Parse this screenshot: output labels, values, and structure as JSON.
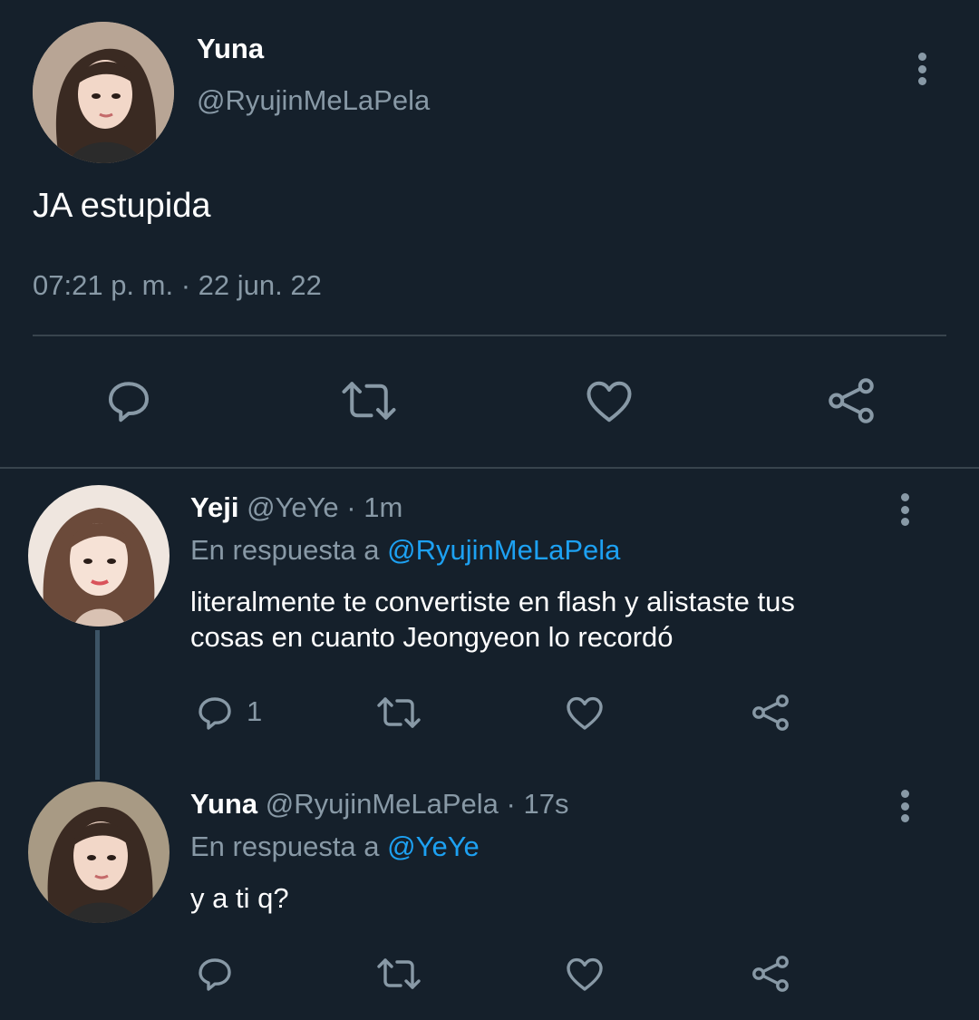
{
  "main_tweet": {
    "display_name": "Yuna",
    "handle": "@RyujinMeLaPela",
    "text": "JA estupida",
    "timestamp": "07:21 p. m. · 22 jun. 22",
    "avatar_icon": "avatar-yuna",
    "actions": [
      "reply-icon",
      "retweet-icon",
      "like-icon",
      "share-icon"
    ]
  },
  "replies": [
    {
      "display_name": "Yeji",
      "handle_time": "@YeYe · 1m",
      "replying_prefix": "En respuesta a",
      "replying_to": "@RyujinMeLaPela",
      "text_line1": "literalmente te convertiste en flash y alistaste tus",
      "text_line2": "cosas en cuanto Jeongyeon lo recordó",
      "reply_count": "1",
      "avatar_icon": "avatar-yeji"
    },
    {
      "display_name": "Yuna",
      "handle_time": "@RyujinMeLaPela · 17s",
      "replying_prefix": "En respuesta a",
      "replying_to": "@YeYe",
      "text_line1": "y a ti q?",
      "reply_count": "",
      "avatar_icon": "avatar-yuna"
    }
  ],
  "colors": {
    "background": "#15202b",
    "text": "#ffffff",
    "muted": "#8899a6",
    "link": "#1da1f2",
    "divider": "#38444d"
  }
}
